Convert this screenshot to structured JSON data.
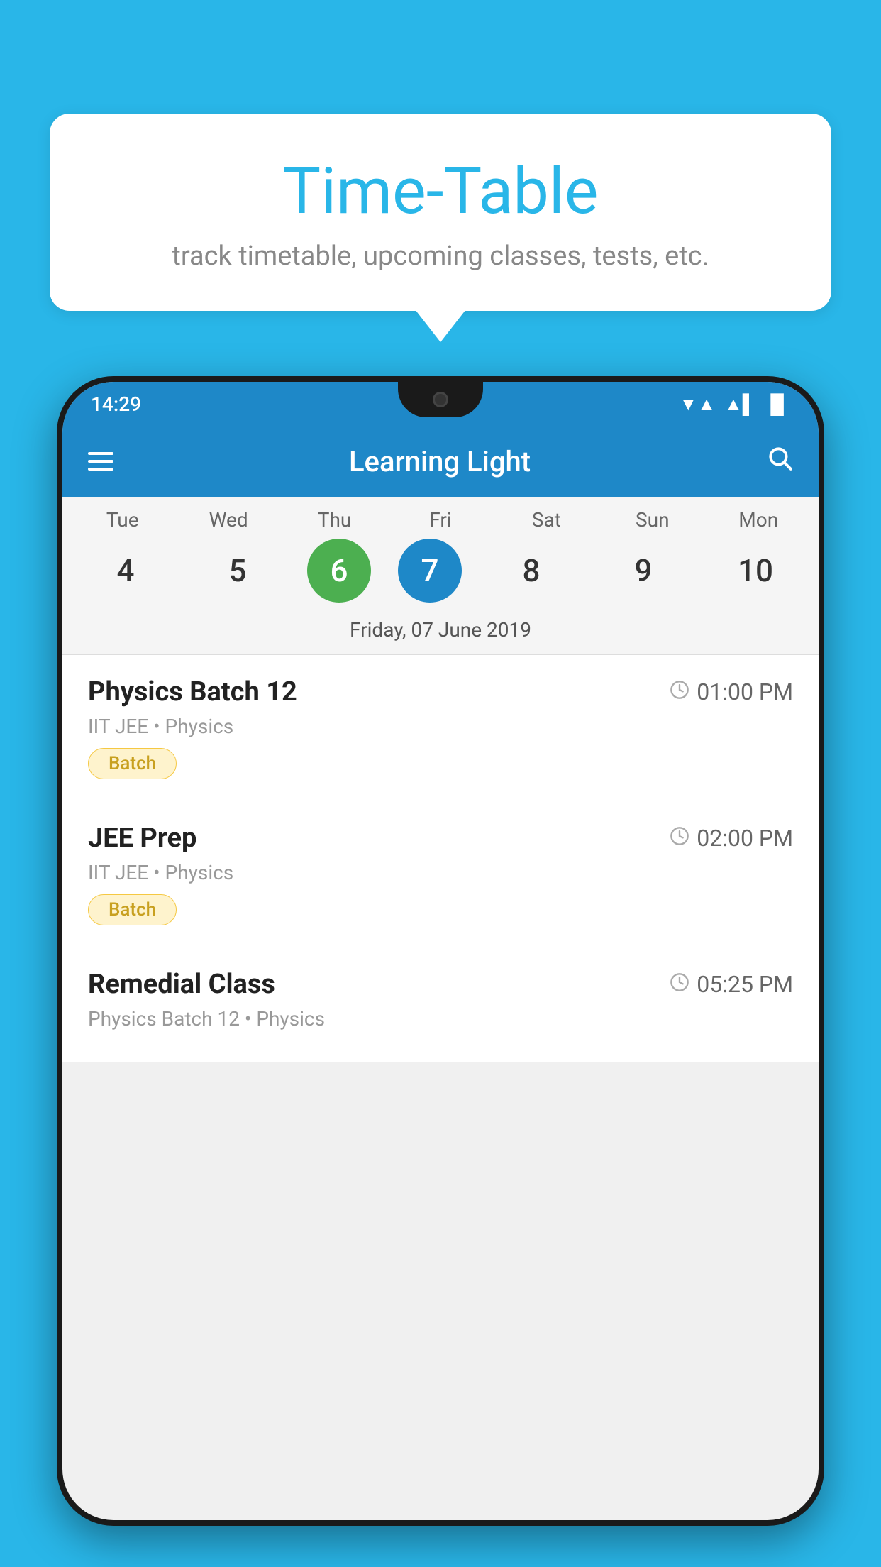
{
  "background_color": "#29b6e8",
  "bubble": {
    "title": "Time-Table",
    "subtitle": "track timetable, upcoming classes, tests, etc."
  },
  "phone": {
    "status_bar": {
      "time": "14:29",
      "wifi": "▼▲",
      "battery": "▐"
    },
    "app_bar": {
      "title": "Learning Light",
      "menu_icon": "hamburger",
      "search_icon": "search"
    },
    "calendar": {
      "days": [
        {
          "label": "Tue",
          "num": "4"
        },
        {
          "label": "Wed",
          "num": "5"
        },
        {
          "label": "Thu",
          "num": "6",
          "state": "today"
        },
        {
          "label": "Fri",
          "num": "7",
          "state": "selected"
        },
        {
          "label": "Sat",
          "num": "8"
        },
        {
          "label": "Sun",
          "num": "9"
        },
        {
          "label": "Mon",
          "num": "10"
        }
      ],
      "selected_date": "Friday, 07 June 2019"
    },
    "schedule": [
      {
        "name": "Physics Batch 12",
        "time": "01:00 PM",
        "meta": "IIT JEE • Physics",
        "badge": "Batch"
      },
      {
        "name": "JEE Prep",
        "time": "02:00 PM",
        "meta": "IIT JEE • Physics",
        "badge": "Batch"
      },
      {
        "name": "Remedial Class",
        "time": "05:25 PM",
        "meta": "Physics Batch 12 • Physics",
        "badge": ""
      }
    ]
  }
}
